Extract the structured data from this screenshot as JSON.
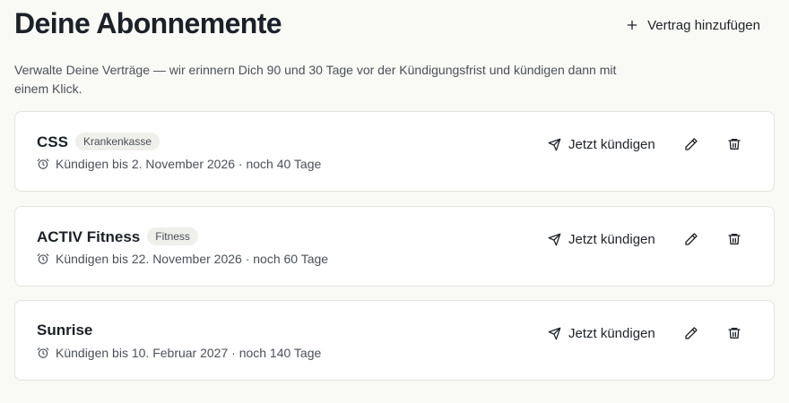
{
  "header": {
    "title": "Deine Abonnemente",
    "add_label": "Vertrag hinzufügen",
    "subtitle": "Verwalte Deine Verträge — wir erinnern Dich 90 und 30 Tage vor der Kündigungsfrist und kündigen dann mit einem Klick."
  },
  "contracts": [
    {
      "name": "CSS",
      "category": "Krankenkasse",
      "deadline": "Kündigen bis 2. November 2026 · noch 40 Tage",
      "cancel_label": "Jetzt kündigen"
    },
    {
      "name": "ACTIV Fitness",
      "category": "Fitness",
      "deadline": "Kündigen bis 22. November 2026 · noch 60 Tage",
      "cancel_label": "Jetzt kündigen"
    },
    {
      "name": "Sunrise",
      "category": "",
      "deadline": "Kündigen bis 10. Februar 2027 · noch 140 Tage",
      "cancel_label": "Jetzt kündigen"
    }
  ],
  "icons": {
    "add": "plus-icon",
    "deadline": "alarm-clock-icon",
    "cancel": "send-icon",
    "edit": "pencil-icon",
    "delete": "trash-icon"
  }
}
